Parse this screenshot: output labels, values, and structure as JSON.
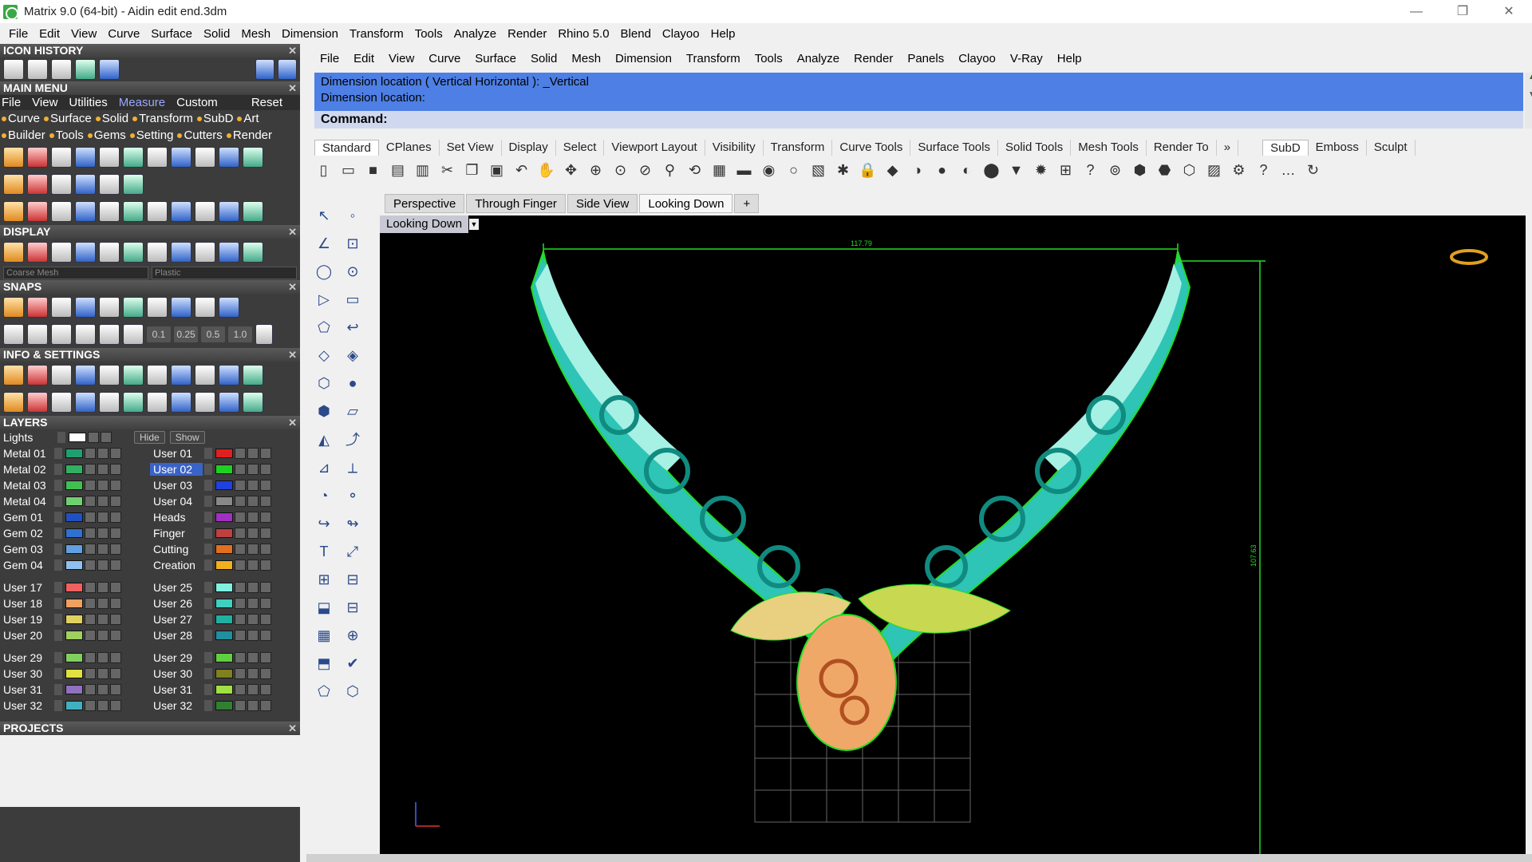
{
  "window": {
    "title": "Matrix 9.0 (64-bit) - Aidin edit end.3dm",
    "min": "—",
    "max": "❐",
    "close": "✕"
  },
  "menubar": [
    "File",
    "Edit",
    "View",
    "Curve",
    "Surface",
    "Solid",
    "Mesh",
    "Dimension",
    "Transform",
    "Tools",
    "Analyze",
    "Render",
    "Rhino 5.0",
    "Blend",
    "Clayoo",
    "Help"
  ],
  "left": {
    "icon_history": "ICON HISTORY",
    "main_menu": "MAIN MENU",
    "main_menu_items": [
      "File",
      "View",
      "Utilities",
      "Measure",
      "Custom"
    ],
    "reset": "Reset",
    "cats1": [
      "Curve",
      "Surface",
      "Solid",
      "Transform",
      "SubD",
      "Art"
    ],
    "cats2": [
      "Builder",
      "Tools",
      "Gems",
      "Setting",
      "Cutters",
      "Render"
    ],
    "display": "DISPLAY",
    "mesh_select": "Coarse Mesh",
    "material_select": "Plastic",
    "snaps": "SNAPS",
    "snap_values": [
      "0.1",
      "0.25",
      "0.5",
      "1.0"
    ],
    "info": "INFO & SETTINGS",
    "layers": "LAYERS",
    "lights": "Lights",
    "hide": "Hide",
    "show": "Show",
    "projects": "PROJECTS",
    "layer_rows": [
      {
        "a": "Metal 01",
        "ac": "#20a070",
        "b": "User 01",
        "bc": "#e02020"
      },
      {
        "a": "Metal 02",
        "ac": "#30b060",
        "b": "User 02",
        "bc": "#20d020"
      },
      {
        "a": "Metal 03",
        "ac": "#40c050",
        "b": "User 03",
        "bc": "#2040e0"
      },
      {
        "a": "Metal 04",
        "ac": "#70d070",
        "b": "User 04",
        "bc": "#888888"
      },
      {
        "a": "Gem 01",
        "ac": "#2050c0",
        "b": "Heads",
        "bc": "#a030c0"
      },
      {
        "a": "Gem 02",
        "ac": "#3070d0",
        "b": "Finger",
        "bc": "#c04040"
      },
      {
        "a": "Gem 03",
        "ac": "#60a0e0",
        "b": "Cutting",
        "bc": "#e07020"
      },
      {
        "a": "Gem 04",
        "ac": "#90c0f0",
        "b": "Creation",
        "bc": "#f0b020"
      }
    ],
    "layer_rows2": [
      {
        "a": "User 17",
        "ac": "#f06060",
        "b": "User 25",
        "bc": "#80f0e0"
      },
      {
        "a": "User 18",
        "ac": "#f0a060",
        "b": "User 26",
        "bc": "#40d0c0"
      },
      {
        "a": "User 19",
        "ac": "#e0d060",
        "b": "User 27",
        "bc": "#20b0a0"
      },
      {
        "a": "User 20",
        "ac": "#a0d060",
        "b": "User 28",
        "bc": "#2090a0"
      }
    ],
    "layer_rows3": [
      {
        "a": "User 29",
        "ac": "#80d060",
        "b": "User 29",
        "bc": "#60d040"
      },
      {
        "a": "User 30",
        "ac": "#e0e040",
        "b": "User 30",
        "bc": "#808020"
      },
      {
        "a": "User 31",
        "ac": "#9070c0",
        "b": "User 31",
        "bc": "#a0e040"
      },
      {
        "a": "User 32",
        "ac": "#40b0c0",
        "b": "User 32",
        "bc": "#308030"
      }
    ]
  },
  "right": {
    "menubar": [
      "File",
      "Edit",
      "View",
      "Curve",
      "Surface",
      "Solid",
      "Mesh",
      "Dimension",
      "Transform",
      "Tools",
      "Analyze",
      "Render",
      "Panels",
      "Clayoo",
      "V-Ray",
      "Help"
    ],
    "cmd_line1": "Dimension location ( Vertical  Horizontal ): _Vertical",
    "cmd_line2": "Dimension location:",
    "cmd_prompt": "Command:",
    "tabs": [
      "Standard",
      "CPlanes",
      "Set View",
      "Display",
      "Select",
      "Viewport Layout",
      "Visibility",
      "Transform",
      "Curve Tools",
      "Surface Tools",
      "Solid Tools",
      "Mesh Tools",
      "Render To"
    ],
    "tabs_more": "»",
    "tabs2": [
      "SubD",
      "Emboss",
      "Sculpt"
    ],
    "viewtabs": [
      "Perspective",
      "Through Finger",
      "Side View",
      "Looking Down"
    ],
    "add_view": "+",
    "active_view": "Looking Down",
    "dim_h": "117.79",
    "dim_v": "107.63"
  },
  "colors": {
    "accent": "#4d7fe4",
    "teal": "#2ec4b6",
    "green": "#22dd22"
  }
}
